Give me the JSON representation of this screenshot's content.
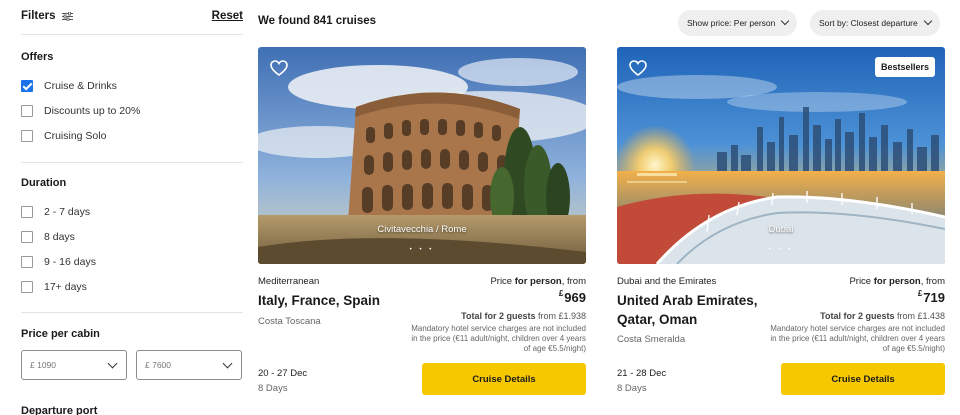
{
  "sidebar": {
    "filters_label": "Filters",
    "reset_label": "Reset",
    "offers": {
      "title": "Offers",
      "items": [
        {
          "label": "Cruise & Drinks",
          "checked": true
        },
        {
          "label": "Discounts up to 20%",
          "checked": false
        },
        {
          "label": "Cruising Solo",
          "checked": false
        }
      ]
    },
    "duration": {
      "title": "Duration",
      "items": [
        {
          "label": "2 - 7 days",
          "checked": false
        },
        {
          "label": "8 days",
          "checked": false
        },
        {
          "label": "9 - 16 days",
          "checked": false
        },
        {
          "label": "17+ days",
          "checked": false
        }
      ]
    },
    "price_per_cabin": {
      "title": "Price per cabin",
      "min_value": "£ 1090",
      "max_value": "£ 7600"
    },
    "departure_port_title": "Departure port"
  },
  "results": {
    "found_label": "We found 841 cruises",
    "show_price_label": "Show price: Per person",
    "sort_label": "Sort by: Closest departure"
  },
  "cards": [
    {
      "region": "Mediterranean",
      "title": "Italy, France, Spain",
      "ship": "Costa Toscana",
      "photo_caption": "Civitavecchia / Rome",
      "badge": "",
      "price_prefix": "Price ",
      "price_bold": "for person",
      "price_suffix": ", from",
      "currency": "£",
      "price": "969",
      "total_bold": "Total for 2 guests",
      "total_rest": " from £1.938",
      "note": "Mandatory hotel service charges are not included in the price (€11 adult/night, children over 4 years of age €5.5/night)",
      "dates": "20 - 27 Dec",
      "days": "8 Days",
      "button_label": "Cruise Details"
    },
    {
      "region": "Dubai and the Emirates",
      "title": "United Arab Emirates, Qatar, Oman",
      "ship": "Costa Smeralda",
      "photo_caption": "Dubai",
      "badge": "Bestsellers",
      "price_prefix": "Price ",
      "price_bold": "for person",
      "price_suffix": ", from",
      "currency": "£",
      "price": "719",
      "total_bold": "Total for 2 guests",
      "total_rest": " from £1.438",
      "note": "Mandatory hotel service charges are not included in the price (€11 adult/night, children over 4 years of age €5.5/night)",
      "dates": "21 - 28 Dec",
      "days": "8 Days",
      "button_label": "Cruise Details"
    }
  ],
  "photo_dots": "• • •",
  "colors": {
    "accent_button": "#f6c800",
    "checkbox_checked": "#1a73e8",
    "pill_bg": "#efefef"
  }
}
